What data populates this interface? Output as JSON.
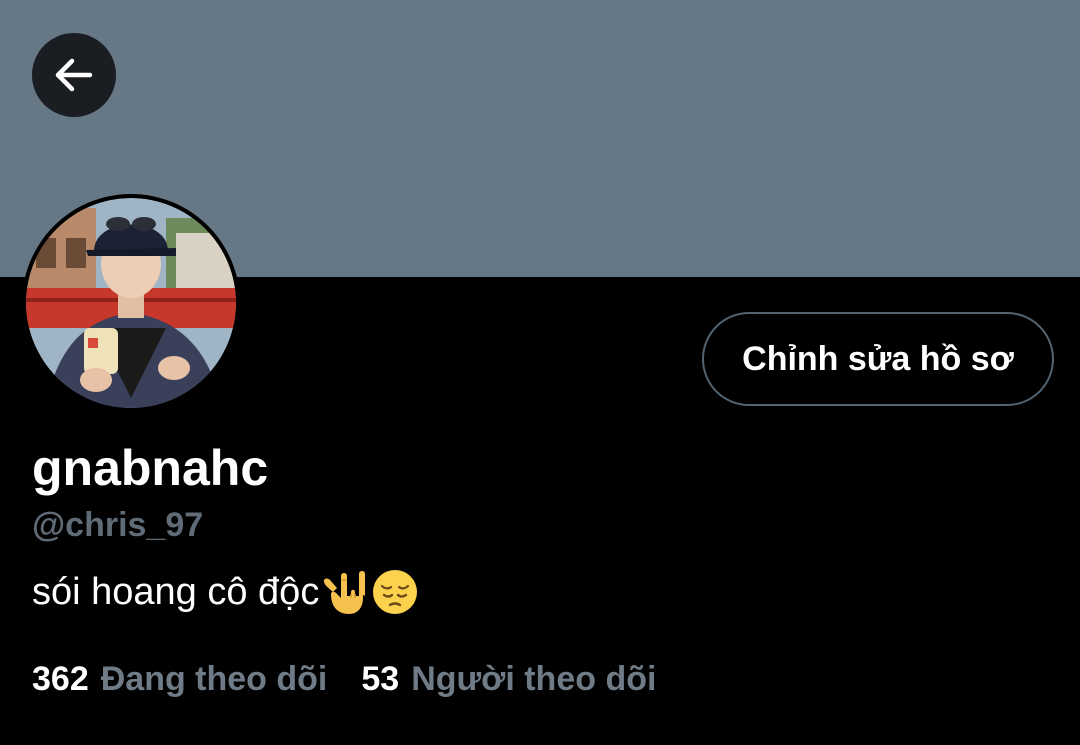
{
  "profile": {
    "display_name": "gnabnahc",
    "handle": "@chris_97",
    "bio_text": "sói hoang cô độc",
    "bio_emojis": [
      "love-you-gesture-emoji",
      "pensive-face-emoji"
    ],
    "edit_button_label": "Chỉnh sửa hồ sơ",
    "following_count": "362",
    "following_label": "Đang theo dõi",
    "followers_count": "53",
    "followers_label": "Người theo dõi"
  },
  "icons": {
    "back": "back-arrow-icon"
  },
  "colors": {
    "banner": "#667786",
    "background": "#000000",
    "muted_text": "#6f7b86",
    "button_border": "#536471"
  }
}
